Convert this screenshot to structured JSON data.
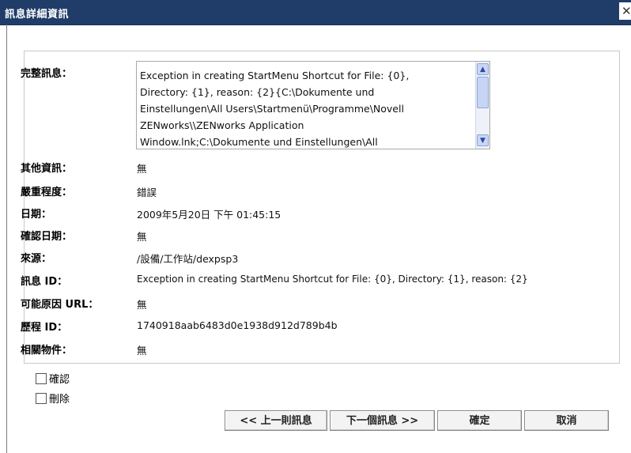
{
  "dialog": {
    "title": "訊息詳細資訊",
    "close_label": "✕"
  },
  "fields": {
    "full_message_label": "完整訊息：",
    "full_message_value": "Exception in creating StartMenu Shortcut for File: {0},\nDirectory: {1}, reason: {2}{C:\\Dokumente und\nEinstellungen\\All Users\\Startmenü\\Programme\\Novell\nZENworks\\\\ZENworks Application\nWindow.lnk;C:\\Dokumente und Einstellungen\\All",
    "other_info_label": "其他資訊：",
    "other_info_value": "無",
    "severity_label": "嚴重程度：",
    "severity_value": "錯誤",
    "date_label": "日期：",
    "date_value": "2009年5月20日 下午 01:45:15",
    "ack_date_label": "確認日期：",
    "ack_date_value": "無",
    "source_label": "來源：",
    "source_value": "/設備/工作站/dexpsp3",
    "message_id_label": "訊息 ID：",
    "message_id_value": "Exception in creating StartMenu Shortcut for File: {0}, Directory: {1}, reason: {2}",
    "cause_url_label": "可能原因 URL：",
    "cause_url_value": "無",
    "history_id_label": "歷程 ID：",
    "history_id_value": "1740918aab6483d0e1938d912d789b4b",
    "related_objects_label": "相關物件：",
    "related_objects_value": "無"
  },
  "checkboxes": {
    "acknowledge_label": "確認",
    "delete_label": "刪除"
  },
  "buttons": {
    "prev_label": "<< 上一則訊息",
    "next_label": "下一個訊息 >>",
    "ok_label": "確定",
    "cancel_label": "取消"
  },
  "colors": {
    "title_bar": "#1f3d68"
  }
}
